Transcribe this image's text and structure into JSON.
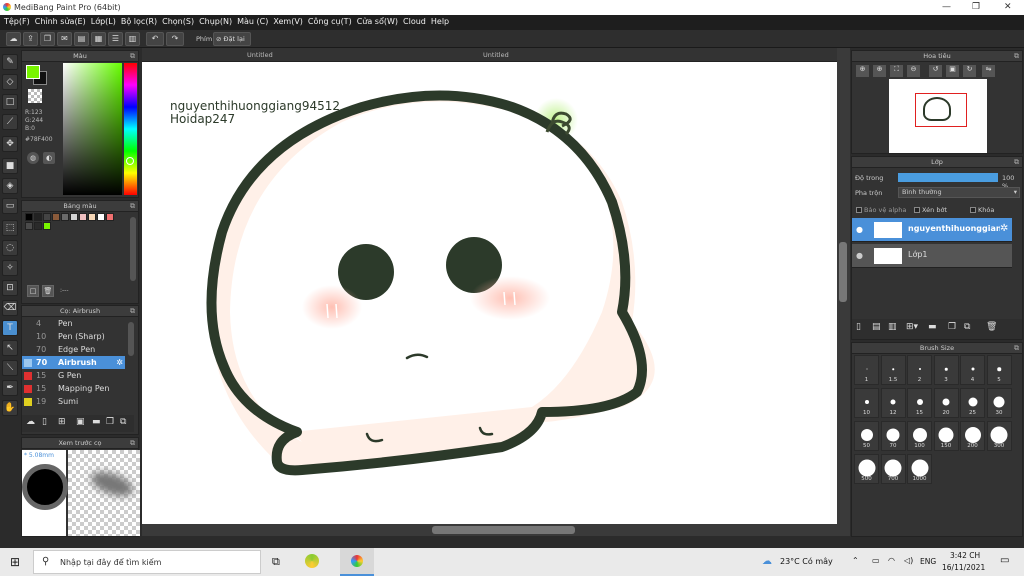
{
  "window": {
    "title": "MediBang Paint Pro (64bit)"
  },
  "menu": [
    "Tệp(F)",
    "Chỉnh sửa(E)",
    "Lớp(L)",
    "Bộ lọc(R)",
    "Chọn(S)",
    "Chụp(N)",
    "Màu (C)",
    "Xem(V)",
    "Công cụ(T)",
    "Cửa sổ(W)",
    "Cloud",
    "Help"
  ],
  "toolbar": {
    "shortcut_label": "Phím",
    "reset_label": "Đặt lại"
  },
  "panels": {
    "color": {
      "title": "Màu",
      "rgb_r": "R:123",
      "rgb_g": "G:244",
      "rgb_b": "B:0",
      "hex": "#78F400",
      "fg": "#78f400",
      "bg": "#111111"
    },
    "palette": {
      "title": "Bảng màu",
      "colors": [
        "#000000",
        "#222222",
        "#444444",
        "#8a5a3a",
        "#6b6b6b",
        "#d2d2d2",
        "#f0c0c0",
        "#f6d6b6",
        "#ffffff",
        "#f07070",
        "#4b4b4b",
        "#2a2a2a",
        "#78f400"
      ],
      "dash": ":---"
    },
    "brush": {
      "title": "Cọ: Airbrush"
    },
    "preview": {
      "title": "Xem trước cọ",
      "size": "5.08mm"
    },
    "navigator": {
      "title": "Hoa tiêu"
    },
    "layer": {
      "title": "Lớp",
      "opacity_label": "Độ trong",
      "opacity_value": "100 %",
      "blend_label": "Pha trộn",
      "blend_value": "Bình thường",
      "protect_alpha": "Bảo vệ alpha",
      "clipping": "Xén bớt",
      "lock": "Khóa"
    },
    "brushsize": {
      "title": "Brush Size"
    }
  },
  "brushes": [
    {
      "num": "4",
      "name": "Pen",
      "color": "#333333"
    },
    {
      "num": "10",
      "name": "Pen (Sharp)",
      "color": "#333333"
    },
    {
      "num": "70",
      "name": "Edge Pen",
      "color": "#333333"
    },
    {
      "num": "70",
      "name": "Airbrush",
      "color": "#4a90d9"
    },
    {
      "num": "15",
      "name": "G Pen",
      "color": "#e03030"
    },
    {
      "num": "15",
      "name": "Mapping Pen",
      "color": "#e03030"
    },
    {
      "num": "19",
      "name": "Sumi",
      "color": "#e0d020"
    }
  ],
  "layers": [
    {
      "name": "nguyenthihuonggiang",
      "selected": true
    },
    {
      "name": "Lớp1",
      "selected": false
    }
  ],
  "brush_sizes": [
    "1",
    "1.5",
    "2",
    "3",
    "4",
    "5",
    "10",
    "12",
    "15",
    "20",
    "25",
    "30",
    "50",
    "70",
    "100",
    "150",
    "200",
    "300",
    "500",
    "700",
    "1000"
  ],
  "tabs": [
    "Untitled",
    "Untitled"
  ],
  "canvas": {
    "text_line1": "nguyenthihuonggiang94512",
    "text_line2": "Hoidap247"
  },
  "taskbar": {
    "search_placeholder": "Nhập tại đây để tìm kiếm",
    "weather": "23°C Có mây",
    "lang": "ENG",
    "time": "3:42 CH",
    "date": "16/11/2021"
  }
}
